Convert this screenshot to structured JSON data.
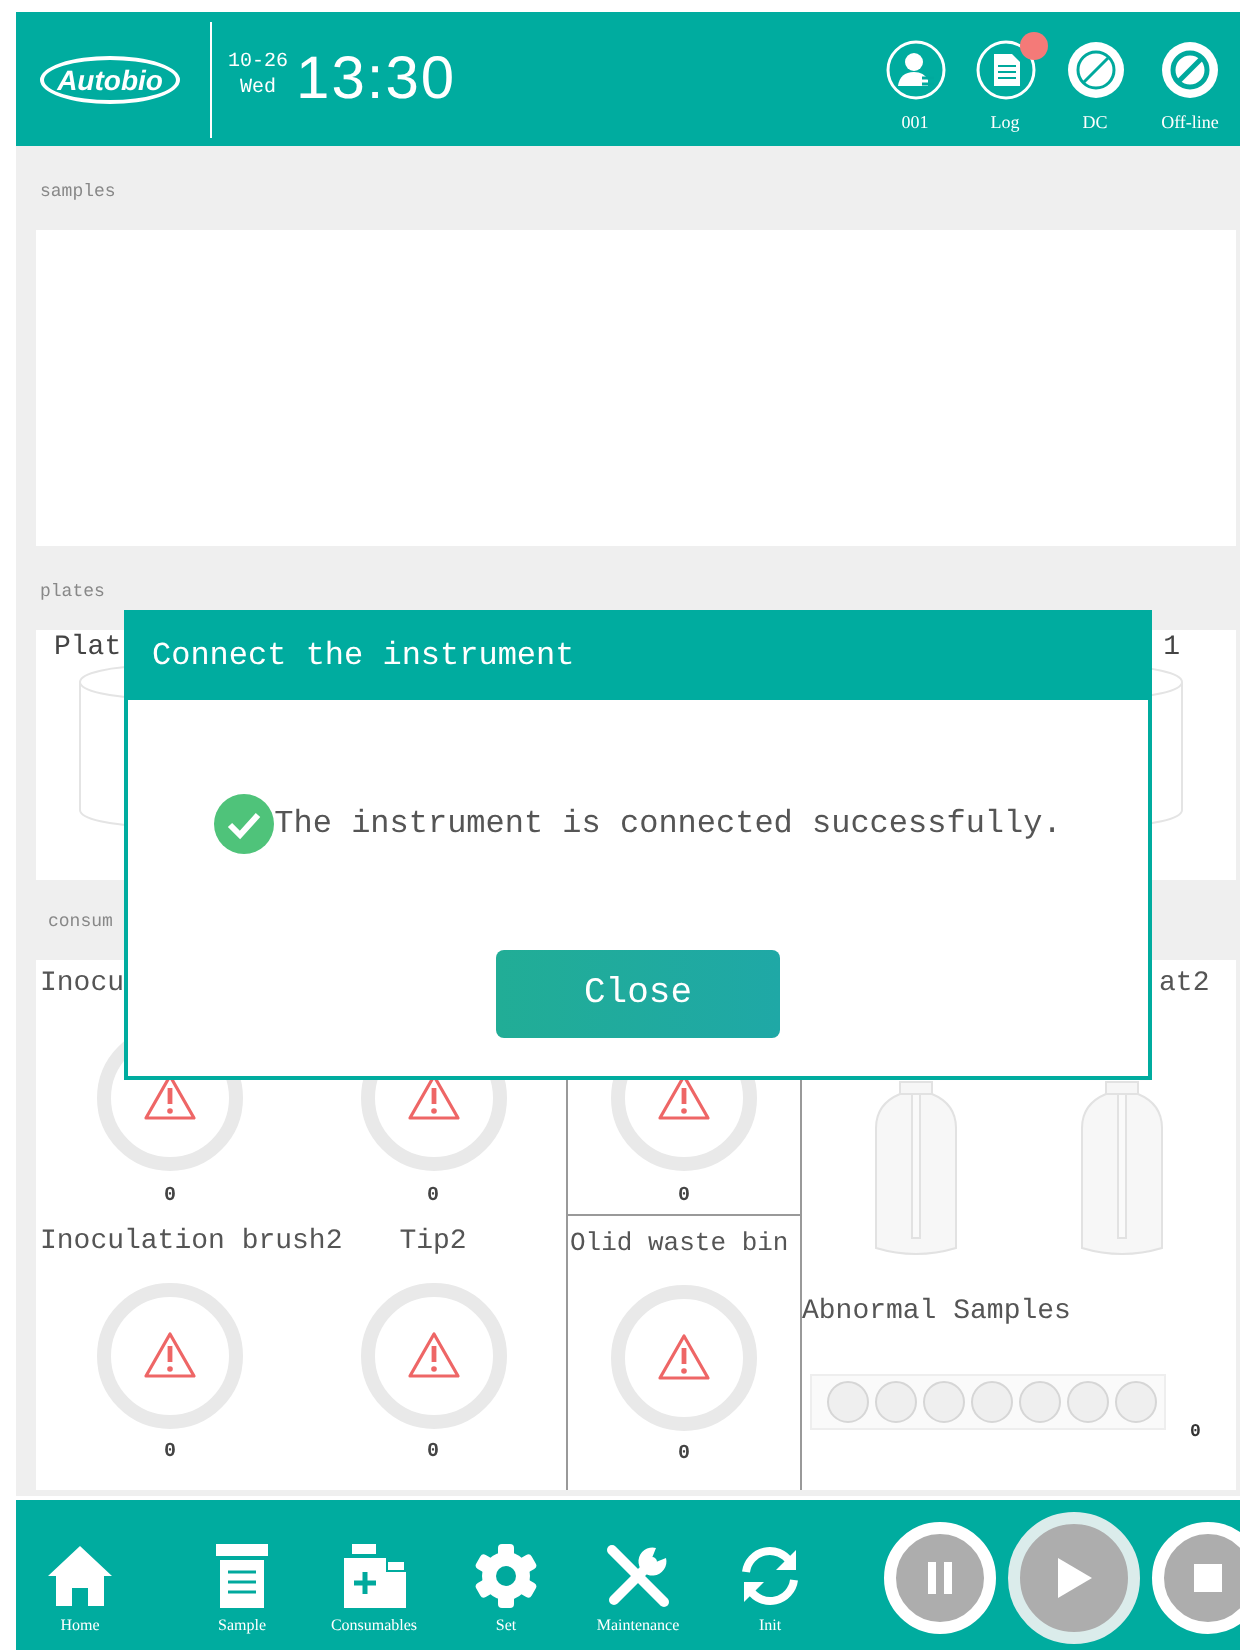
{
  "header": {
    "logo": "Autobio",
    "date": "10-26",
    "weekday": "Wed",
    "time": "13:30",
    "status_items": [
      {
        "label": "001",
        "kind": "user",
        "alert": false
      },
      {
        "label": "Log",
        "kind": "log",
        "alert": true
      },
      {
        "label": "DC",
        "kind": "dc",
        "alert": false
      },
      {
        "label": "Off-line",
        "kind": "offline",
        "alert": false
      }
    ]
  },
  "samples": {
    "label": "samples"
  },
  "plates": {
    "label": "plates",
    "left_label": "Plat",
    "right_label": "1"
  },
  "consumables": {
    "label": "consum",
    "items": [
      {
        "label": "Inocu",
        "count": "0"
      },
      {
        "count": "0"
      },
      {
        "count": "0"
      },
      {
        "label": "Inoculation brush2",
        "count": "0"
      },
      {
        "label": "Tip2",
        "count": "0"
      },
      {
        "label": "Olid waste bin",
        "count": "0"
      }
    ],
    "bottles": [
      {
        "kind": "bottle"
      },
      {
        "kind": "bottle",
        "label": "at2"
      }
    ],
    "abnormal": {
      "label": "Abnormal Samples",
      "count": "0"
    }
  },
  "dialog": {
    "title": "Connect the instrument",
    "message": "The instrument is connected successfully.",
    "button": "Close"
  },
  "nav": [
    {
      "label": "Home",
      "kind": "home"
    },
    {
      "label": "Sample",
      "kind": "sample"
    },
    {
      "label": "Consumables",
      "kind": "consumables"
    },
    {
      "label": "Set",
      "kind": "set"
    },
    {
      "label": "Maintenance",
      "kind": "maintenance"
    },
    {
      "label": "Init",
      "kind": "init"
    }
  ],
  "controls": [
    {
      "kind": "pause",
      "selected": false
    },
    {
      "kind": "play",
      "selected": true
    },
    {
      "kind": "stop",
      "selected": false
    }
  ]
}
